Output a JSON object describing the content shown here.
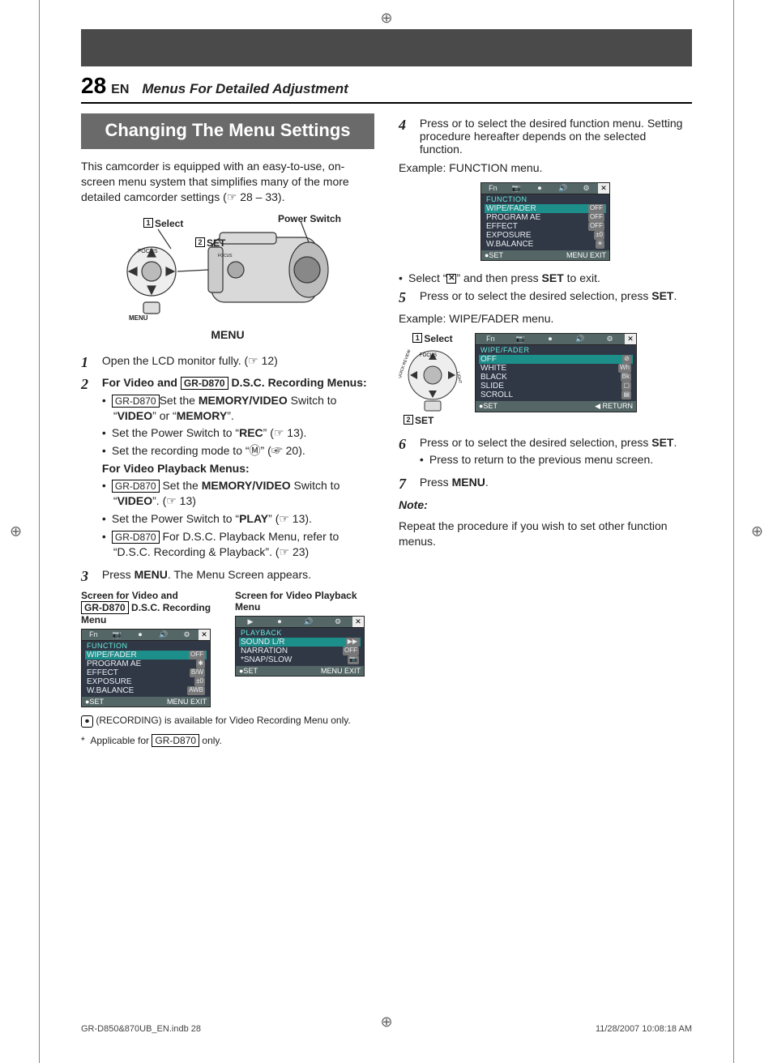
{
  "page": {
    "number": "28",
    "lang": "EN",
    "section": "Menus For Detailed Adjustment",
    "heading": "Changing The Menu Settings",
    "intro": "This camcorder is equipped with an easy-to-use, on-screen menu system that simplifies many of the more detailed camcorder settings (☞ 28 – 33).",
    "diagram": {
      "select_lbl": "Select",
      "set_lbl": "SET",
      "power_lbl": "Power Switch",
      "menu_lbl": "MENU",
      "menu_cap": "MENU",
      "circ1": "1",
      "circ2": "2"
    },
    "step1": {
      "num": "1",
      "text": "Open the LCD monitor fully. (☞ 12)"
    },
    "step2": {
      "num": "2",
      "lead_a": "For Video and ",
      "model": "GR-D870",
      "lead_b": " D.S.C. Recording Menus:",
      "b1a": "Set the ",
      "b1_model": "GR-D870",
      "b1b": "MEMORY/VIDEO",
      "b1c": " Switch to “",
      "b1d": "VIDEO",
      "b1e": "” or “",
      "b1f": "MEMORY",
      "b1g": "”.",
      "b2a": "Set the Power Switch to “",
      "b2b": "REC",
      "b2c": "” (☞ 13).",
      "b3": "Set the recording mode to “Ⓜ” (☞ 20).",
      "pb_head": "For Video Playback Menus:",
      "pb1_model": "GR-D870",
      "pb1a": " Set the ",
      "pb1b": "MEMORY/VIDEO",
      "pb1c": " Switch to “",
      "pb1d": "VIDEO",
      "pb1e": "”. (☞ 13)",
      "pb2a": "Set the Power Switch to “",
      "pb2b": "PLAY",
      "pb2c": "” (☞ 13).",
      "pb3_model": "GR-D870",
      "pb3a": " For D.S.C. Playback Menu, refer to “D.S.C. Recording & Playback”. (☞ 23)"
    },
    "step3": {
      "num": "3",
      "a": "Press ",
      "b": "MENU",
      "c": ". The Menu Screen appears."
    },
    "shots": {
      "cap1a": "Screen for Video and ",
      "cap1_model": "GR-D870",
      "cap1b": " D.S.C. Recording Menu",
      "cap2": "Screen for Video Playback Menu",
      "shot1": {
        "tabs": [
          "Fn",
          "📷",
          "⏺",
          "🔊",
          "⚙"
        ],
        "title": "FUNCTION",
        "items": [
          [
            "WIPE/FADER",
            "OFF"
          ],
          [
            "PROGRAM AE",
            "✱"
          ],
          [
            "EFFECT",
            "B/W"
          ],
          [
            "EXPOSURE",
            "±0"
          ],
          [
            "W.BALANCE",
            "AWB"
          ]
        ],
        "f1": "●SET",
        "f2": "MENU",
        "f3": "EXIT"
      },
      "shot2": {
        "tabs": [
          "▶",
          "⏺",
          "🔊",
          "⚙"
        ],
        "title": "PLAYBACK",
        "items": [
          [
            "SOUND L/R",
            "▶▶"
          ],
          [
            "NARRATION",
            "OFF"
          ],
          [
            "*SNAP/SLOW",
            "📷"
          ]
        ],
        "f1": "●SET",
        "f2": "MENU",
        "f3": "EXIT"
      }
    },
    "rec_note": "(RECORDING) is available for Video Recording Menu only.",
    "star_a": "Applicable for ",
    "star_model": "GR-D870",
    "star_b": " only.",
    "step4": {
      "num": "4",
      "a": "Press   or   to select the desired function menu. Setting procedure hereafter depends on the selected function.",
      "ex": "Example: FUNCTION menu."
    },
    "shot3": {
      "tabs": [
        "Fn",
        "📷",
        "⏺",
        "🔊",
        "⚙"
      ],
      "title": "FUNCTION",
      "items": [
        [
          "WIPE/FADER",
          "OFF"
        ],
        [
          "PROGRAM AE",
          "OFF"
        ],
        [
          "EFFECT",
          "OFF"
        ],
        [
          "EXPOSURE",
          "±0"
        ],
        [
          "W.BALANCE",
          "☀"
        ]
      ],
      "f1": "●SET",
      "f2": "MENU",
      "f3": "EXIT"
    },
    "exit_a": "Select “",
    "exit_b": "” and then press ",
    "exit_c": "SET",
    "exit_d": " to exit.",
    "step5": {
      "num": "5",
      "a": "Press   or   to select the desired selection, press ",
      "b": "SET",
      "c": ".",
      "ex": "Example: WIPE/FADER menu."
    },
    "dialbox": {
      "sel": "Select",
      "set": "SET",
      "c1": "1",
      "c2": "2"
    },
    "shot4": {
      "tabs": [
        "Fn",
        "📷",
        "⏺",
        "🔊",
        "⚙"
      ],
      "title": "WIPE/FADER",
      "items": [
        [
          "OFF",
          "⊘"
        ],
        [
          "WHITE",
          "Wh"
        ],
        [
          "BLACK",
          "Bk"
        ],
        [
          "SLIDE",
          "▢"
        ],
        [
          "SCROLL",
          "▤"
        ]
      ],
      "f1": "●SET",
      "f2": "◀ RETURN"
    },
    "step6": {
      "num": "6",
      "a": "Press   or   to select the desired selection, press ",
      "b": "SET",
      "c": ".",
      "sub": "Press   to return to the previous menu screen."
    },
    "step7": {
      "num": "7",
      "a": "Press ",
      "b": "MENU",
      "c": "."
    },
    "note_head": "Note:",
    "note_body": "Repeat the procedure if you wish to set other function menus."
  },
  "footer": {
    "file": "GR-D850&870UB_EN.indb   28",
    "date": "11/28/2007   10:08:18 AM"
  }
}
